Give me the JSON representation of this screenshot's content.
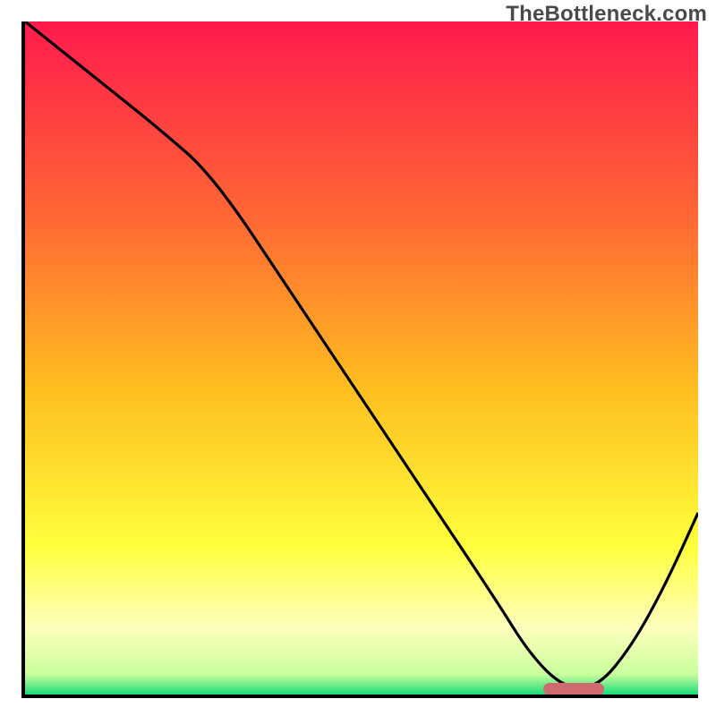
{
  "attribution": "TheBottleneck.com",
  "colors": {
    "gradient_top": "#ff1a4d",
    "gradient_upper_mid": "#ff6a33",
    "gradient_mid": "#ffbf1f",
    "gradient_lower_mid": "#ffff3d",
    "gradient_pale": "#ffffbd",
    "gradient_bottom": "#1adb7a",
    "curve": "#000000",
    "marker": "#cf6a6e",
    "axis": "#000000"
  },
  "chart_data": {
    "type": "line",
    "title": "",
    "xlabel": "",
    "ylabel": "",
    "xlim": [
      0,
      100
    ],
    "ylim": [
      0,
      100
    ],
    "legend": false,
    "grid": false,
    "series": [
      {
        "name": "bottleneck-curve",
        "x": [
          0,
          10,
          20,
          28,
          40,
          50,
          60,
          70,
          75,
          80,
          85,
          90,
          95,
          100
        ],
        "values": [
          100,
          92,
          84,
          77,
          59,
          44,
          29,
          14,
          6,
          1,
          1,
          7,
          16,
          27
        ]
      }
    ],
    "annotations": [
      {
        "name": "optimum-marker",
        "x_start": 77,
        "x_end": 86,
        "y": 0.8,
        "color": "#cf6a6e"
      }
    ],
    "background_gradient_stops": [
      {
        "offset": 0.0,
        "color": "#ff1a4d"
      },
      {
        "offset": 0.3,
        "color": "#ff6a33"
      },
      {
        "offset": 0.55,
        "color": "#ffbf1f"
      },
      {
        "offset": 0.78,
        "color": "#ffff3d"
      },
      {
        "offset": 0.9,
        "color": "#ffffbd"
      },
      {
        "offset": 0.97,
        "color": "#c9ff9c"
      },
      {
        "offset": 1.0,
        "color": "#1adb7a"
      }
    ]
  }
}
